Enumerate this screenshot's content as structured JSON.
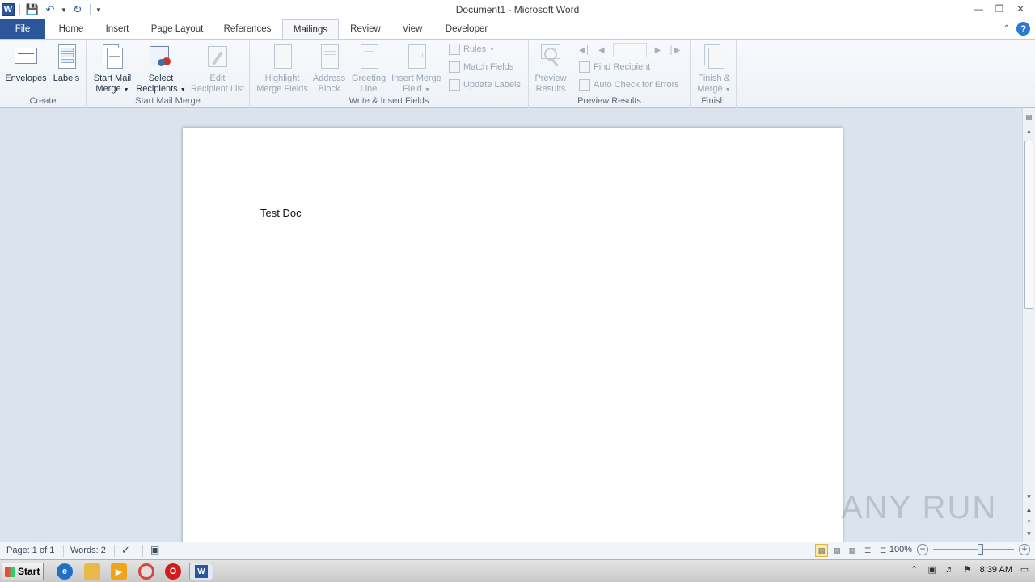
{
  "window": {
    "title": "Document1  -  Microsoft Word"
  },
  "qat": {
    "app_icon": "word-icon",
    "save_icon": "save-icon",
    "undo_icon": "undo-icon",
    "redo_icon": "redo-icon",
    "customize_icon": "customize-qat-icon"
  },
  "tabs": [
    {
      "label": "File"
    },
    {
      "label": "Home"
    },
    {
      "label": "Insert"
    },
    {
      "label": "Page Layout"
    },
    {
      "label": "References"
    },
    {
      "label": "Mailings"
    },
    {
      "label": "Review"
    },
    {
      "label": "View"
    },
    {
      "label": "Developer"
    }
  ],
  "active_tab": "Mailings",
  "ribbon": {
    "create": {
      "label": "Create",
      "envelopes": "Envelopes",
      "labels": "Labels"
    },
    "start_mail_merge": {
      "label": "Start Mail Merge",
      "start_line1": "Start Mail",
      "start_line2": "Merge",
      "select_line1": "Select",
      "select_line2": "Recipients",
      "edit_line1": "Edit",
      "edit_line2": "Recipient List"
    },
    "write_insert": {
      "label": "Write & Insert Fields",
      "highlight_line1": "Highlight",
      "highlight_line2": "Merge Fields",
      "address_line1": "Address",
      "address_line2": "Block",
      "greeting_line1": "Greeting",
      "greeting_line2": "Line",
      "insert_line1": "Insert Merge",
      "insert_line2": "Field",
      "rules": "Rules",
      "match_fields": "Match Fields",
      "update_labels": "Update Labels"
    },
    "preview": {
      "label": "Preview Results",
      "preview_line1": "Preview",
      "preview_line2": "Results",
      "find_recipient": "Find Recipient",
      "auto_check": "Auto Check for Errors",
      "record_value": ""
    },
    "finish": {
      "label": "Finish",
      "finish_line1": "Finish &",
      "finish_line2": "Merge"
    }
  },
  "document": {
    "body_text": "Test Doc"
  },
  "watermark": "ANY RUN",
  "status": {
    "page": "Page: 1 of 1",
    "words": "Words: 2",
    "zoom": "100%"
  },
  "taskbar": {
    "start_label": "Start",
    "time": "8:39 AM"
  },
  "colors": {
    "file_tab": "#2b579a",
    "ribbon_bg": "#f5f7fa",
    "doc_bg": "#dbe4ee"
  }
}
